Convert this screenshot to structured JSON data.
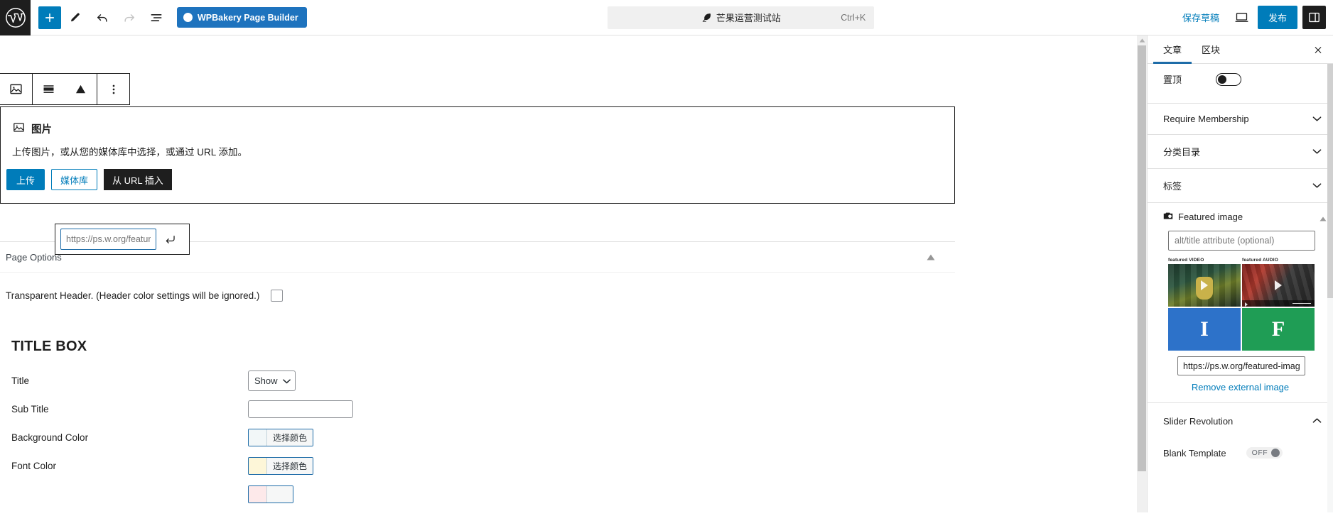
{
  "topbar": {
    "logo_icon": "wordpress-logo-icon",
    "add_block_label": "+",
    "tools": [
      {
        "name": "add-block-button",
        "icon": "plus-icon"
      },
      {
        "name": "edit-tool-button",
        "icon": "pencil-icon"
      },
      {
        "name": "undo-button",
        "icon": "undo-arrow-icon"
      },
      {
        "name": "redo-button",
        "icon": "redo-arrow-icon"
      },
      {
        "name": "list-view-button",
        "icon": "list-view-icon"
      }
    ],
    "wpbakery_label": "WPBakery Page Builder",
    "document_title": "芒果运营测试站",
    "document_shortcut": "Ctrl+K",
    "save_draft_label": "保存草稿",
    "preview_icon": "laptop-preview-icon",
    "publish_label": "发布",
    "settings_icon": "sidebar-panel-icon"
  },
  "block_toolbar": {
    "buttons": [
      {
        "name": "block-type-image-button",
        "icon": "image-icon"
      },
      {
        "name": "align-button",
        "icon": "align-full-icon"
      },
      {
        "name": "crop-button",
        "icon": "triangle-icon"
      },
      {
        "name": "more-options-button",
        "icon": "vertical-dots-icon"
      }
    ]
  },
  "image_block": {
    "icon": "image-icon",
    "title": "图片",
    "description": "上传图片，或从您的媒体库中选择，或通过 URL 添加。",
    "upload_label": "上传",
    "media_library_label": "媒体库",
    "insert_from_url_label": "从 URL 插入"
  },
  "url_popover": {
    "input_value": "https://ps.w.org/featured-",
    "submit_icon": "enter-return-icon"
  },
  "page_options": {
    "title": "Page Options",
    "collapse_icon": "triangle-up-icon",
    "transparent_header_label": "Transparent Header. (Header color settings will be ignored.)",
    "transparent_header_checked": false
  },
  "title_box": {
    "heading": "TITLE BOX",
    "rows": [
      {
        "label": "Title",
        "type": "select",
        "value": "Show",
        "name": "title-visibility-select"
      },
      {
        "label": "Sub Title",
        "type": "text",
        "value": "",
        "name": "sub-title-input"
      },
      {
        "label": "Background Color",
        "type": "color",
        "value": "选择颜色",
        "swatch": "default",
        "name": "background-color-picker"
      },
      {
        "label": "Font Color",
        "type": "color",
        "value": "选择颜色",
        "swatch": "yellowish",
        "name": "font-color-picker"
      }
    ],
    "color_button_label": "选择颜色"
  },
  "sidebar": {
    "tabs": [
      {
        "label": "文章",
        "active": true,
        "name": "tab-post"
      },
      {
        "label": "区块",
        "active": false,
        "name": "tab-block"
      }
    ],
    "close_icon": "close-x-icon",
    "sticky": {
      "label": "置顶",
      "enabled": false
    },
    "accordions": [
      {
        "label": "Require Membership",
        "name": "panel-require-membership",
        "icon": "chevron-down-icon"
      },
      {
        "label": "分类目录",
        "name": "panel-categories",
        "icon": "chevron-down-icon"
      },
      {
        "label": "标签",
        "name": "panel-tags",
        "icon": "chevron-down-icon"
      }
    ],
    "featured_image": {
      "icon": "camera-icon",
      "title": "Featured image",
      "collapse_icon": "triangle-up-icon",
      "alt_placeholder": "alt/title attribute (optional)",
      "alt_value": "",
      "thumb_labels": [
        "featured VIDEO",
        "featured AUDIO"
      ],
      "thumbs": [
        {
          "name": "thumbnail-featured-video",
          "kind": "video"
        },
        {
          "name": "thumbnail-featured-audio",
          "kind": "audio"
        },
        {
          "name": "thumbnail-instagram",
          "kind": "letter",
          "glyph": "I"
        },
        {
          "name": "thumbnail-facebook",
          "kind": "letter",
          "glyph": "F"
        }
      ],
      "url_value": "https://ps.w.org/featured-image-",
      "remove_label": "Remove external image"
    },
    "slider_revolution": {
      "label": "Slider Revolution",
      "collapse_icon": "chevron-up-icon",
      "blank_template_label": "Blank Template",
      "blank_template_state": "OFF"
    }
  },
  "colors": {
    "accent": "#007cba",
    "wpbakery": "#1e73be",
    "dark": "#1e1e1e",
    "border": "#e0e0e0"
  }
}
